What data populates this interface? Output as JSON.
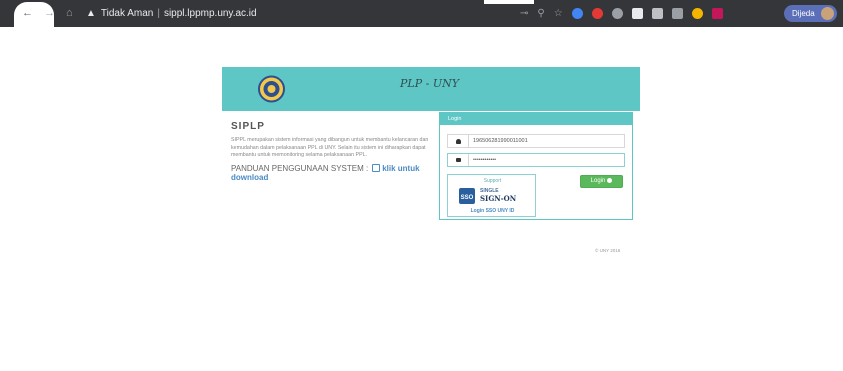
{
  "browser": {
    "security_label": "Tidak Aman",
    "separator": "|",
    "url": "sippl.lppmp.uny.ac.id",
    "profile_name": "Dijeda",
    "toolbar_icons": [
      "key-icon",
      "zoom-icon",
      "star-icon",
      "extension-icon",
      "extension-icon",
      "extension-icon",
      "extension-icon",
      "extension-icon",
      "extension-icon",
      "extension-icon",
      "extension-icon"
    ]
  },
  "header": {
    "brand": "PLP - UNY"
  },
  "intro": {
    "title": "SIPLP",
    "description": "SIPPL merupakan sistem informasi yang dibangun untuk membantu kelancaran dan kemudahan dalam pelaksanaan PPL di UNY. Selain itu sistem ini diharapkan dapat membantu untuk memonitoring selama pelaksanaan PPL.",
    "guide_label": "PANDUAN PENGGUNAAN SYSTEM :",
    "guide_link": "klik untuk download"
  },
  "login": {
    "heading": "Login",
    "username_value": "196506281990011001",
    "password_value": "••••••••••••",
    "button_label": "Login",
    "sso": {
      "support": "Support",
      "sso_badge": "SSO",
      "single": "SINGLE",
      "sign_on": "SIGN-ON",
      "link": "Login SSO UNY ID"
    }
  },
  "footer": {
    "copyright": "© UNY 2016"
  },
  "colors": {
    "accent": "#5fc6c6",
    "button": "#5cb85c",
    "link": "#4a8bc4"
  }
}
